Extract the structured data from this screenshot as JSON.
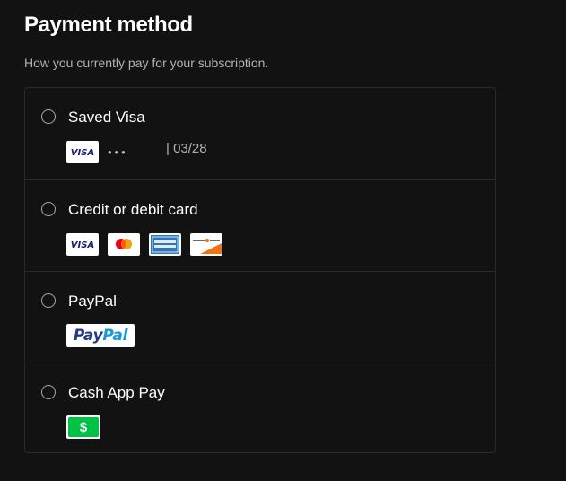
{
  "header": {
    "title": "Payment method",
    "subtitle": "How you currently pay for your subscription."
  },
  "methods": [
    {
      "label": "Saved Visa",
      "logos": [
        "visa-icon"
      ],
      "masked_number": "•••",
      "expiry": "| 03/28",
      "selected": false
    },
    {
      "label": "Credit or debit card",
      "logos": [
        "visa-icon",
        "mastercard-icon",
        "amex-icon",
        "discover-icon"
      ],
      "selected": false
    },
    {
      "label": "PayPal",
      "logos": [
        "paypal-logo"
      ],
      "logo_text": {
        "part1": "Pay",
        "part2": "Pal"
      },
      "selected": false
    },
    {
      "label": "Cash App Pay",
      "logos": [
        "cash-app-icon"
      ],
      "logo_text": "$",
      "selected": false
    }
  ],
  "colors": {
    "background": "#121212",
    "border": "#2a2a2a",
    "text_primary": "#ffffff",
    "text_secondary": "#b3b3b3",
    "visa_blue": "#1a1f71",
    "paypal_dark": "#253b80",
    "paypal_light": "#179bd7",
    "cashapp_green": "#00c244"
  }
}
